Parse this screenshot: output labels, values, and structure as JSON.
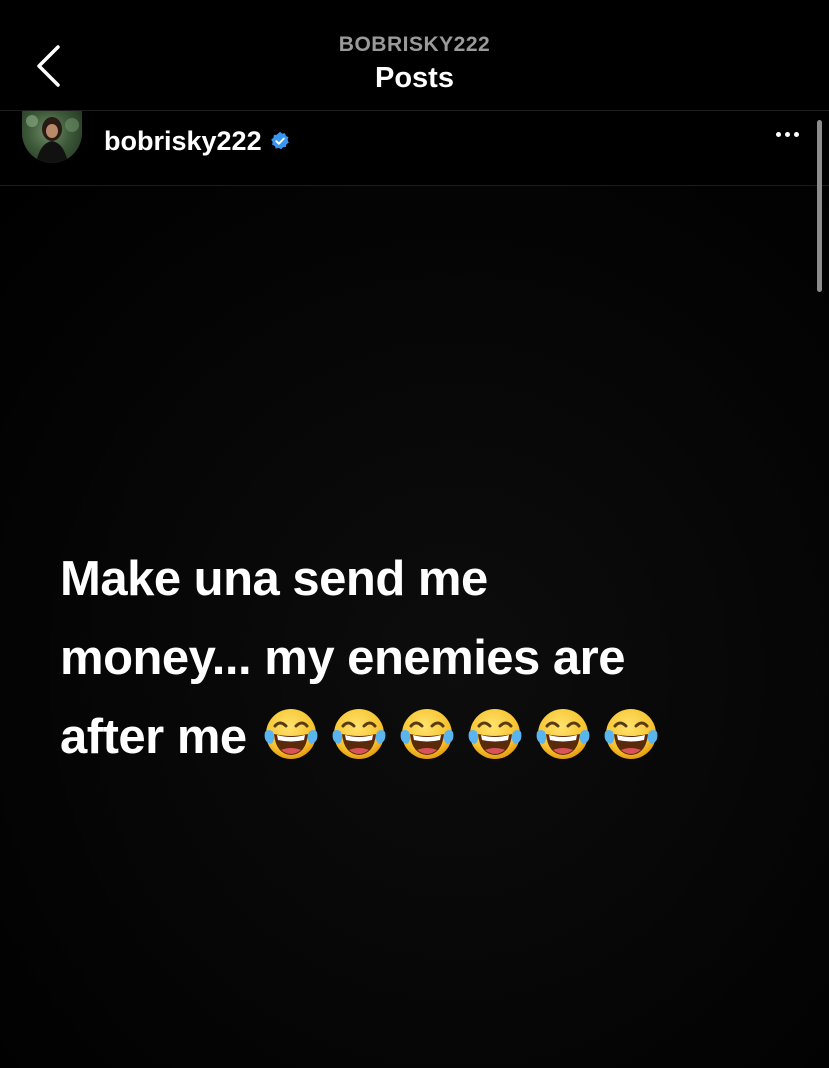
{
  "header": {
    "subtitle": "BOBRISKY222",
    "title": "Posts"
  },
  "post": {
    "username": "bobrisky222",
    "verified": true,
    "text_lines": [
      "Make una send me",
      "money... my enemies are",
      "after me"
    ],
    "emoji": "face-with-tears-of-joy",
    "emoji_count": 6
  },
  "colors": {
    "background": "#000000",
    "verified_badge": "#3797f0",
    "header_subtitle": "#9a9a9a"
  }
}
